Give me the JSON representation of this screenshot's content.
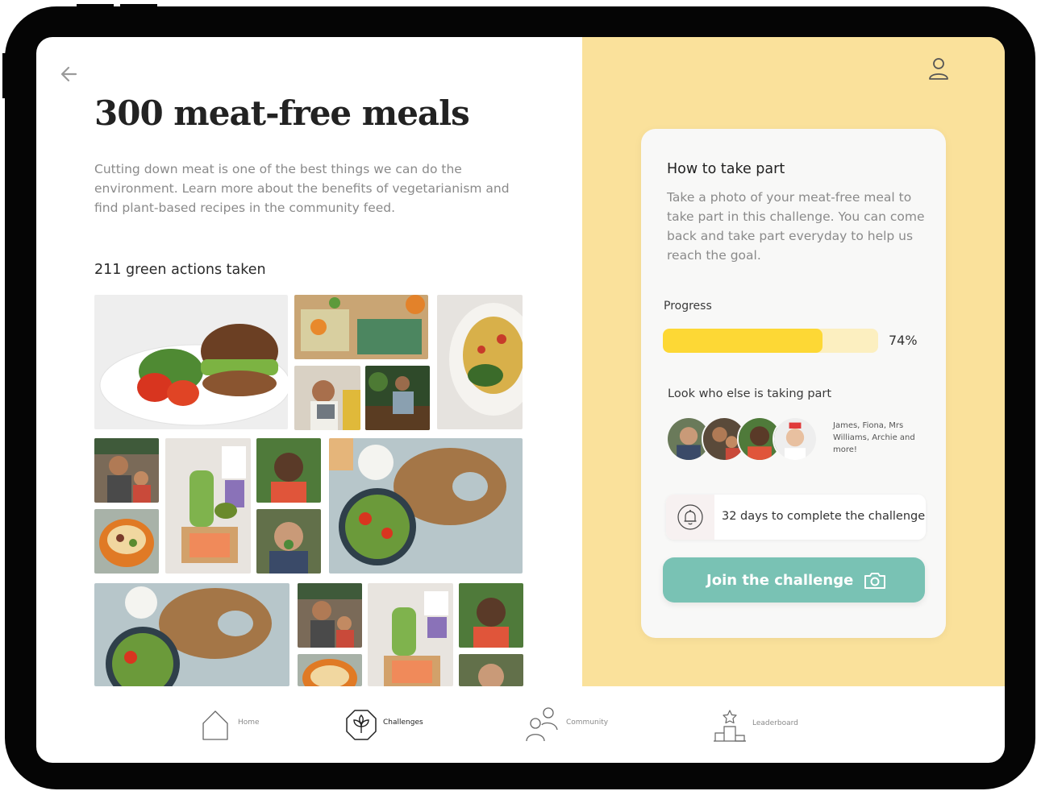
{
  "header": {
    "title": "300 meat-free meals",
    "description": "Cutting down meat is one of the best things we can do the environment. Learn more about the benefits of vegetarianism and find plant-based recipes in the community feed.",
    "actions_count": "211 green actions taken"
  },
  "card": {
    "title": "How to take part",
    "description": "Take a photo of your meat-free meal to take part in this challenge. You can come back and take part everyday to help us reach the goal.",
    "progress_label": "Progress",
    "progress_value": "74%",
    "progress_fraction": 0.74,
    "participants_label": "Look who else is taking part",
    "participants_names": "James, Fiona, Mrs Williams, Archie and more!",
    "deadline_text": "32 days to complete the challenge",
    "join_label": "Join the challenge"
  },
  "nav": {
    "items": [
      {
        "label": "Home",
        "icon": "home-icon",
        "active": false
      },
      {
        "label": "Challenges",
        "icon": "plant-icon",
        "active": true
      },
      {
        "label": "Community",
        "icon": "community-icon",
        "active": false
      },
      {
        "label": "Leaderboard",
        "icon": "trophy-podium-icon",
        "active": false
      }
    ]
  },
  "colors": {
    "panel_bg": "#fae19b",
    "progress_fill": "#fdd835",
    "progress_track": "#fcefc0",
    "join_button": "#79c2b4",
    "device_frame": "#050505"
  },
  "photos": [
    "burger-salad-photo",
    "beeswax-wraps-photo",
    "pasta-photo",
    "child-tablet-photo",
    "gardener-photo",
    "family-kitchen-photo",
    "salmon-bokchoy-photo",
    "smiling-woman-photo",
    "salad-board-photo",
    "stuffed-pepper-photo",
    "boy-eating-photo",
    "salad-board-photo-2",
    "family-kitchen-photo-2",
    "salmon-bokchoy-photo-2",
    "smiling-woman-photo-2",
    "stuffed-pepper-photo-2",
    "boy-eating-photo-2"
  ]
}
